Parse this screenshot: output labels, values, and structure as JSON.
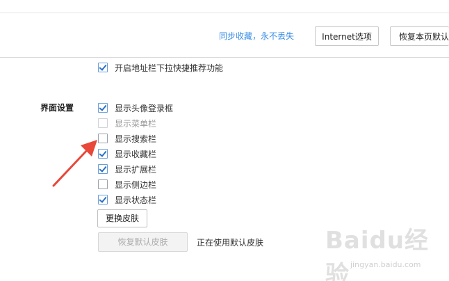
{
  "header": {
    "sync_link": "同步收藏，永不丢失",
    "internet_options_button": "Internet选项",
    "restore_page_default_button": "恢复本页默认"
  },
  "address_bar": {
    "dropdown_suggestion": {
      "label": "开启地址栏下拉快捷推荐功能",
      "checked": true
    }
  },
  "interface_settings": {
    "title": "界面设置",
    "items": [
      {
        "label": "显示头像登录框",
        "checked": true,
        "disabled": false
      },
      {
        "label": "显示菜单栏",
        "checked": false,
        "disabled": true
      },
      {
        "label": "显示搜索栏",
        "checked": false,
        "disabled": false
      },
      {
        "label": "显示收藏栏",
        "checked": true,
        "disabled": false
      },
      {
        "label": "显示扩展栏",
        "checked": true,
        "disabled": false
      },
      {
        "label": "显示侧边栏",
        "checked": false,
        "disabled": false
      },
      {
        "label": "显示状态栏",
        "checked": true,
        "disabled": false
      }
    ],
    "change_skin_button": "更换皮肤",
    "restore_default_skin_button": "恢复默认皮肤",
    "skin_status": "正在使用默认皮肤"
  },
  "watermark": {
    "brand": "Baidu经验",
    "url": "jingyan.baidu.com"
  },
  "colors": {
    "link": "#3a8ee6",
    "check": "#2b6fc4",
    "arrow": "#e8473a"
  }
}
